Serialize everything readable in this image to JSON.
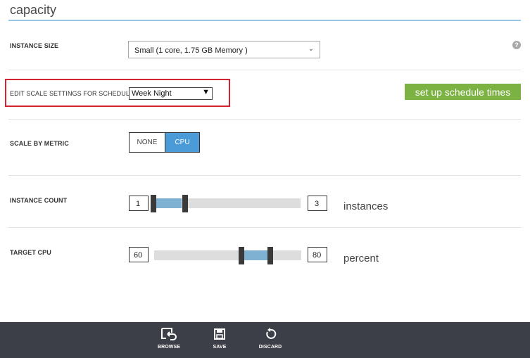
{
  "section": {
    "title": "capacity"
  },
  "instance_size": {
    "label": "INSTANCE SIZE",
    "selected": "Small (1 core, 1.75 GB Memory )",
    "help_glyph": "?"
  },
  "schedule": {
    "label": "EDIT SCALE SETTINGS FOR SCHEDULE",
    "selected": "Week Night",
    "setup_button": "set up schedule times"
  },
  "scale_by_metric": {
    "label": "SCALE BY METRIC",
    "options": [
      "NONE",
      "CPU"
    ],
    "selected": "CPU"
  },
  "instance_count": {
    "label": "INSTANCE COUNT",
    "min": "1",
    "max": "3",
    "unit": "instances"
  },
  "target_cpu": {
    "label": "TARGET CPU",
    "min": "60",
    "max": "80",
    "unit": "percent"
  },
  "command_bar": {
    "browse": "BROWSE",
    "save": "SAVE",
    "discard": "DISCARD"
  },
  "colors": {
    "accent_blue": "#4b9bd8",
    "button_green": "#7cb241",
    "highlight_red": "#d32330",
    "command_bar": "#3c3f48"
  }
}
